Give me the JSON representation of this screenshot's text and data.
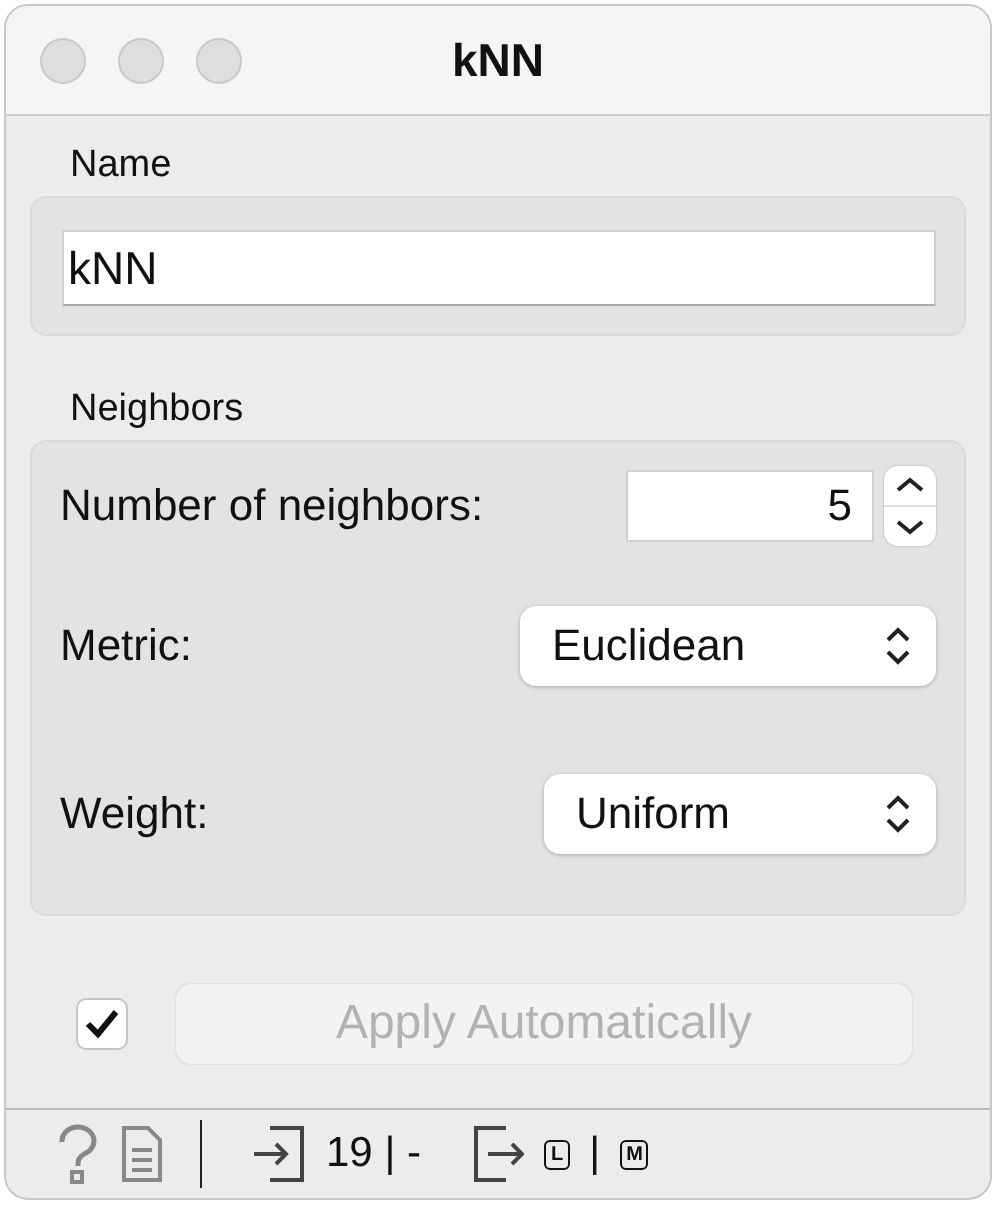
{
  "window": {
    "title": "kNN"
  },
  "name_box": {
    "label": "Name",
    "value": "kNN"
  },
  "neighbors_box": {
    "label": "Neighbors",
    "rows": [
      {
        "kind": "spin",
        "label": "Number of neighbors:",
        "value": "5"
      },
      {
        "kind": "select",
        "label": "Metric:",
        "value": "Euclidean"
      },
      {
        "kind": "select",
        "label": "Weight:",
        "value": "Uniform"
      }
    ]
  },
  "apply": {
    "checked": true,
    "label": "Apply Automatically",
    "disabled": true
  },
  "status_bar": {
    "input_count": "19 | -",
    "output_first": "L",
    "separator": "|",
    "output_second": "M"
  }
}
